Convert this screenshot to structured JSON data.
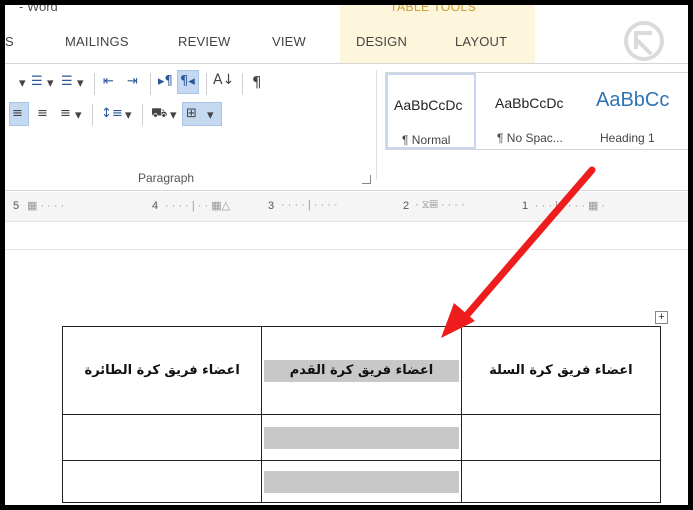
{
  "window": {
    "title": "- Word",
    "context_group": "TABLE TOOLS"
  },
  "tabs": [
    "S",
    "MAILINGS",
    "REVIEW",
    "VIEW",
    "DESIGN",
    "LAYOUT"
  ],
  "paragraph_group": {
    "label": "Paragraph"
  },
  "styles": [
    {
      "sample": "AaBbCcDc",
      "name": "¶ Normal"
    },
    {
      "sample": "AaBbCcDc",
      "name": "¶ No Spac..."
    },
    {
      "sample": "AaBbCc",
      "name": "Heading 1"
    }
  ],
  "ruler": {
    "numbers": [
      "5",
      "4",
      "3",
      "2",
      "1"
    ]
  },
  "table": {
    "headers": [
      "اعضاء فريق كرة الطائرة",
      "اعضاء فريق كرة القدم",
      "اعضاء فريق كرة السلة"
    ]
  },
  "colors": {
    "arrow": "#ee1c1c",
    "shading": "#c8c8c8",
    "table_tools": "#fdf5dc"
  }
}
